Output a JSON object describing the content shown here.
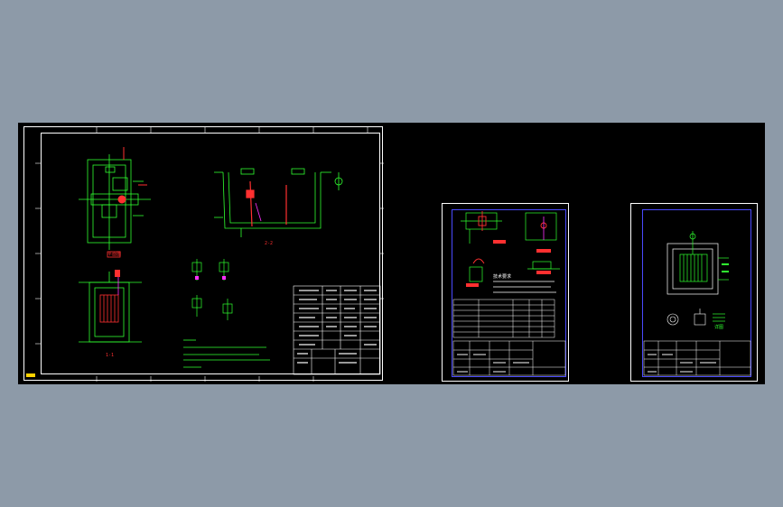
{
  "colors": {
    "background": "#8d9aa8",
    "modelspace": "#000000",
    "sheet_border": "#ffffff",
    "frame_blue": "#4a4aff",
    "line_green": "#30ff30",
    "line_red": "#ff3030",
    "line_magenta": "#ff30ff",
    "layer_tag": "#ffd200"
  },
  "icons": [
    "layer-tag-icon"
  ],
  "drawing": {
    "sheet_left": {
      "section_label_1": "1-1",
      "section_label_2": "2-2",
      "plan_label": "平面图"
    },
    "sheet_middle": {
      "note_title": "技术要求"
    },
    "sheet_right": {
      "detail_label": "详图"
    }
  }
}
